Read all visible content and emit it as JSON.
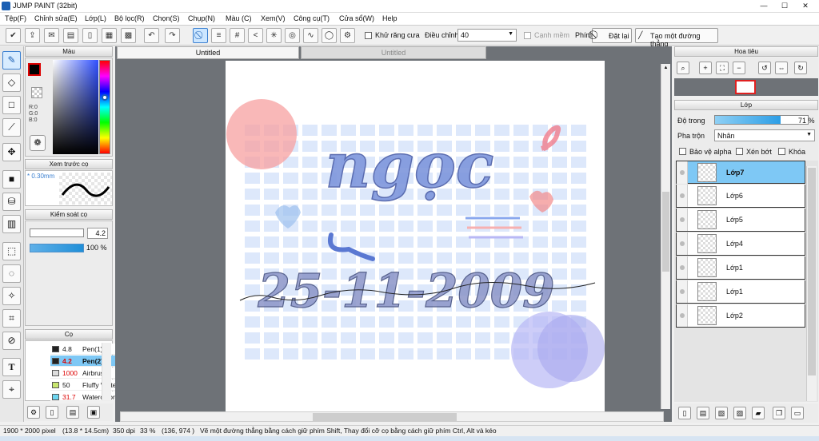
{
  "window": {
    "title": "JUMP PAINT (32bit)",
    "min_icon": "minimize-icon",
    "max_icon": "maximize-icon",
    "close_icon": "close-icon"
  },
  "menu": [
    "Tệp(F)",
    "Chỉnh sửa(E)",
    "Lớp(L)",
    "Bộ lọc(R)",
    "Chọn(S)",
    "Chụp(N)",
    "Màu (C)",
    "Xem(V)",
    "Công cụ(T)",
    "Cửa sổ(W)",
    "Help"
  ],
  "toolbar": {
    "antialias_label": "Khử răng cưa",
    "adjust_label": "Điều chỉnh",
    "adjust_value": "40",
    "edge_label": "Cạnh mềm",
    "pen_label": "Phím",
    "reset_label": "Đặt lại",
    "straight_label": "Tạo một đường thẳng"
  },
  "tabs": [
    "Untitled",
    "Untitled"
  ],
  "color_panel": {
    "title": "Màu",
    "r": "R:0",
    "g": "G:0",
    "b": "B:0"
  },
  "preview_panel": {
    "title": "Xem trước cọ",
    "size": "* 0.30mm"
  },
  "control_panel": {
    "title": "Kiểm soát cọ",
    "size_value": "4.2",
    "opacity_value": "100 %"
  },
  "brush_panel": {
    "title": "Cọ",
    "items": [
      {
        "size": "4.8",
        "name": "Pen(1)",
        "color": "#222222"
      },
      {
        "size": "4.2",
        "name": "Pen(2)",
        "color": "#222222"
      },
      {
        "size": "1000",
        "name": "Airbrush",
        "color": "#cccccc"
      },
      {
        "size": "50",
        "name": "Fluffy Watercolor",
        "color": "#c8e66e"
      },
      {
        "size": "31.7",
        "name": "Watercolor (",
        "color": "#6ed6f0"
      }
    ]
  },
  "navigator": {
    "title": "Hoa tiêu"
  },
  "layer_panel": {
    "title": "Lớp",
    "opacity_label": "Độ trong",
    "opacity_value": "71 %",
    "opacity_fraction": 0.71,
    "blend_label": "Pha trộn",
    "blend_value": "Nhân",
    "protect_alpha": "Bảo vệ alpha",
    "clip": "Xén bớt",
    "lock": "Khóa",
    "layers": [
      "Lớp7",
      "Lớp6",
      "Lớp5",
      "Lớp4",
      "Lớp1",
      "Lớp1",
      "Lớp2"
    ]
  },
  "artwork": {
    "word1": "ngọc",
    "word2": "25-11-2009"
  },
  "status": {
    "size": "1900 * 2000 pixel",
    "cm": "(13.8 * 14.5cm)",
    "dpi": "350 dpi",
    "zoom": "33 %",
    "coords": "(136, 974 )",
    "hint": "Vẽ một đường thẳng bằng cách giữ phím Shift, Thay đổi cỡ cọ bằng cách giữ phím Ctrl, Alt và kéo"
  },
  "colors": {
    "accent": "#3a7fd0",
    "selected_row": "#7ec8f5"
  }
}
